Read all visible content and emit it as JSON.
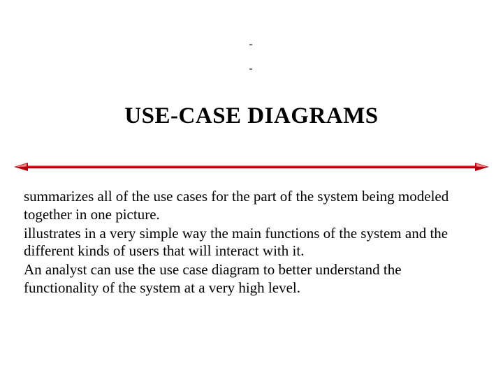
{
  "title": "USE-CASE DIAGRAMS",
  "paragraphs": {
    "p1": "summarizes all of the use cases for the part of the system being modeled together in one picture.",
    "p2": "illustrates in a very simple way the main functions of the system and the different kinds of users that will interact with it.",
    "p3": "An analyst can use the use case diagram to better understand the functionality of the system at a very high level."
  },
  "colors": {
    "accent": "#d4000e",
    "accent_highlight": "#ff8a8a"
  }
}
